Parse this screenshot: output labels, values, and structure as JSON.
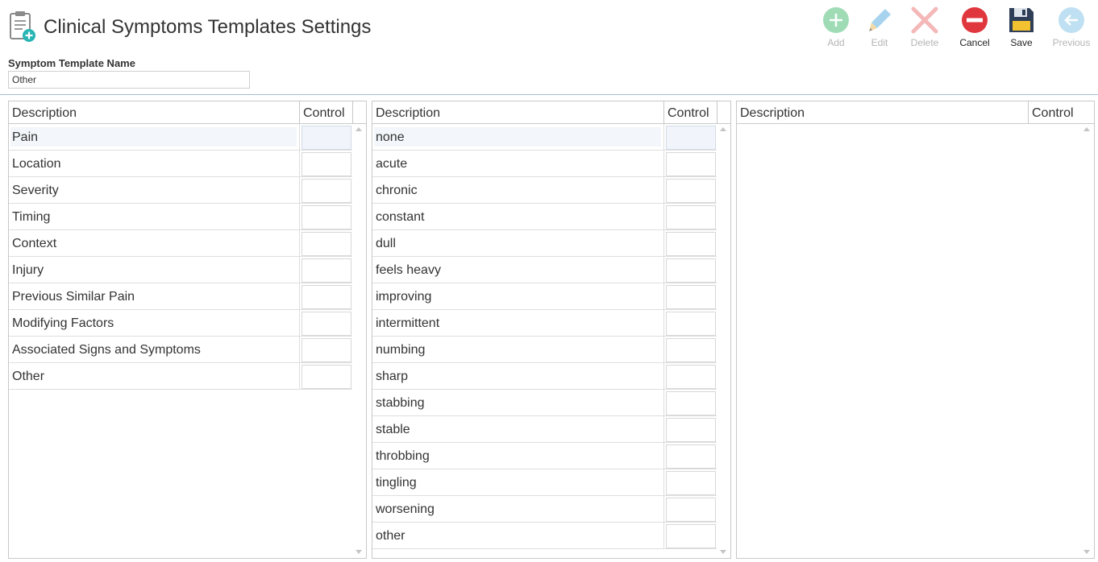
{
  "header": {
    "title": "Clinical Symptoms Templates Settings",
    "icon": "clipboard-add-icon"
  },
  "form": {
    "label": "Symptom Template Name",
    "value": "Other"
  },
  "toolbar": {
    "add": "Add",
    "edit": "Edit",
    "delete": "Delete",
    "cancel": "Cancel",
    "save": "Save",
    "previous": "Previous"
  },
  "colors": {
    "add": "#9fdcb6",
    "edit": "#a8d3ef",
    "delete": "#f4b8b8",
    "cancel": "#e0363d",
    "save_body": "#2f3f57",
    "save_label": "#f2c230",
    "previous": "#bfe0f2",
    "divider": "#a9bdd0"
  },
  "grids": [
    {
      "headers": {
        "description": "Description",
        "control": "Control"
      },
      "rows": [
        "Pain",
        "Location",
        "Severity",
        "Timing",
        "Context",
        "Injury",
        "Previous Similar Pain",
        "Modifying Factors",
        "Associated Signs and Symptoms",
        "Other"
      ]
    },
    {
      "headers": {
        "description": "Description",
        "control": "Control"
      },
      "rows": [
        "none",
        "acute",
        "chronic",
        "constant",
        "dull",
        "feels heavy",
        "improving",
        "intermittent",
        "numbing",
        "sharp",
        "stabbing",
        "stable",
        "throbbing",
        "tingling",
        "worsening",
        "other"
      ]
    },
    {
      "headers": {
        "description": "Description",
        "control": "Control"
      },
      "rows": []
    }
  ]
}
